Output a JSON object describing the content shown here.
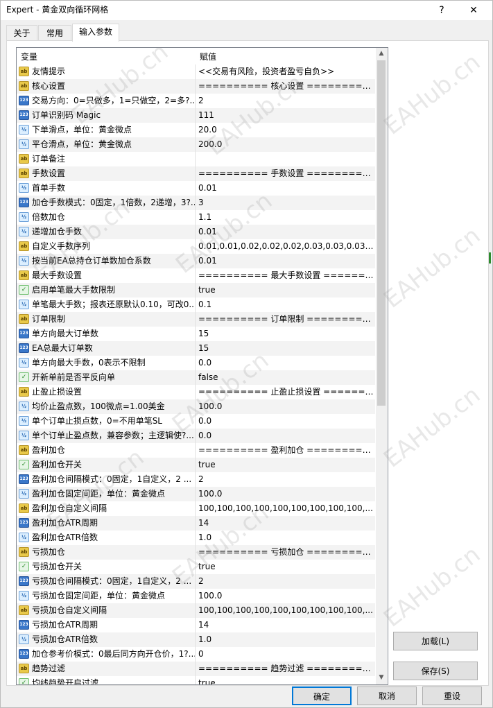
{
  "window": {
    "title": "Expert - 黄金双向循环网格",
    "help_label": "?",
    "close_label": "✕"
  },
  "tabs": [
    {
      "label": "关于"
    },
    {
      "label": "常用"
    },
    {
      "label": "输入参数"
    }
  ],
  "grid": {
    "col_variable": "变量",
    "col_value": "赋值",
    "rows": [
      {
        "type": "ab",
        "name": "友情提示",
        "value": "<<交易有风险，投资者盈亏自负>>"
      },
      {
        "type": "ab",
        "name": "核心设置",
        "value": "========== 核心设置 =========="
      },
      {
        "type": "123",
        "name": "交易方向：0=只做多，1=只做空，2=多?..",
        "value": "2"
      },
      {
        "type": "123",
        "name": "订单识别码 Magic",
        "value": "111"
      },
      {
        "type": "v2",
        "name": "下单滑点，单位：黄金微点",
        "value": "20.0"
      },
      {
        "type": "v2",
        "name": "平仓滑点，单位：黄金微点",
        "value": "200.0"
      },
      {
        "type": "ab",
        "name": "订单备注",
        "value": ""
      },
      {
        "type": "ab",
        "name": "手数设置",
        "value": "========== 手数设置 =========="
      },
      {
        "type": "v2",
        "name": "首单手数",
        "value": "0.01"
      },
      {
        "type": "123",
        "name": "加仓手数模式：0固定，1倍数，2递增，3?..",
        "value": "3"
      },
      {
        "type": "v2",
        "name": "倍数加仓",
        "value": "1.1"
      },
      {
        "type": "v2",
        "name": "递增加仓手数",
        "value": "0.01"
      },
      {
        "type": "ab",
        "name": "自定义手数序列",
        "value": "0.01,0.01,0.02,0.02,0.02,0.03,0.03,0.03,0.04..."
      },
      {
        "type": "v2",
        "name": "按当前EA总持仓订单数加仓系数",
        "value": "0.01"
      },
      {
        "type": "ab",
        "name": "最大手数设置",
        "value": "========== 最大手数设置 =======..."
      },
      {
        "type": "bool",
        "name": "启用单笔最大手数限制",
        "value": "true"
      },
      {
        "type": "v2",
        "name": "单笔最大手数；报表还原默认0.10，可改0...",
        "value": "0.1"
      },
      {
        "type": "ab",
        "name": "订单限制",
        "value": "========== 订单限制 =========="
      },
      {
        "type": "123",
        "name": "单方向最大订单数",
        "value": "15"
      },
      {
        "type": "123",
        "name": "EA总最大订单数",
        "value": "15"
      },
      {
        "type": "v2",
        "name": "单方向最大手数，0表示不限制",
        "value": "0.0"
      },
      {
        "type": "bool",
        "name": "开新单前是否平反向单",
        "value": "false"
      },
      {
        "type": "ab",
        "name": "止盈止损设置",
        "value": "========== 止盈止损设置 =======..."
      },
      {
        "type": "v2",
        "name": "均价止盈点数，100微点=1.00美金",
        "value": "100.0"
      },
      {
        "type": "v2",
        "name": "单个订单止损点数，0=不用单笔SL",
        "value": "0.0"
      },
      {
        "type": "v2",
        "name": "单个订单止盈点数，兼容参数；主逻辑使?...",
        "value": "0.0"
      },
      {
        "type": "ab",
        "name": "盈利加仓",
        "value": "========== 盈利加仓 =========="
      },
      {
        "type": "bool",
        "name": "盈利加仓开关",
        "value": "true"
      },
      {
        "type": "123",
        "name": "盈利加仓间隔模式：0固定，1自定义，2 ...",
        "value": "2"
      },
      {
        "type": "v2",
        "name": "盈利加仓固定间距，单位：黄金微点",
        "value": "100.0"
      },
      {
        "type": "ab",
        "name": "盈利加仓自定义间隔",
        "value": "100,100,100,100,100,100,100,100,100,..."
      },
      {
        "type": "123",
        "name": "盈利加仓ATR周期",
        "value": "14"
      },
      {
        "type": "v2",
        "name": "盈利加仓ATR倍数",
        "value": "1.0"
      },
      {
        "type": "ab",
        "name": "亏损加仓",
        "value": "========== 亏损加仓 =========="
      },
      {
        "type": "bool",
        "name": "亏损加仓开关",
        "value": "true"
      },
      {
        "type": "123",
        "name": "亏损加仓间隔模式：0固定，1自定义，2 ...",
        "value": "2"
      },
      {
        "type": "v2",
        "name": "亏损加仓固定间距，单位：黄金微点",
        "value": "100.0"
      },
      {
        "type": "ab",
        "name": "亏损加仓自定义间隔",
        "value": "100,100,100,100,100,100,100,100,100,..."
      },
      {
        "type": "123",
        "name": "亏损加仓ATR周期",
        "value": "14"
      },
      {
        "type": "v2",
        "name": "亏损加仓ATR倍数",
        "value": "1.0"
      },
      {
        "type": "123",
        "name": "加仓参考价模式：0最后同方向开仓价，1?...",
        "value": "0"
      },
      {
        "type": "ab",
        "name": "趋势过滤",
        "value": "========== 趋势过滤 =========="
      },
      {
        "type": "bool",
        "name": "均线趋势开启过滤",
        "value": "true"
      }
    ]
  },
  "icons": {
    "ab": "ab",
    "123": "123",
    "v2": "½",
    "bool": "✓"
  },
  "buttons": {
    "load": "加载(L)",
    "save": "保存(S)",
    "ok": "确定",
    "cancel": "取消",
    "reset": "重设"
  },
  "watermark": "EAHub.cn"
}
